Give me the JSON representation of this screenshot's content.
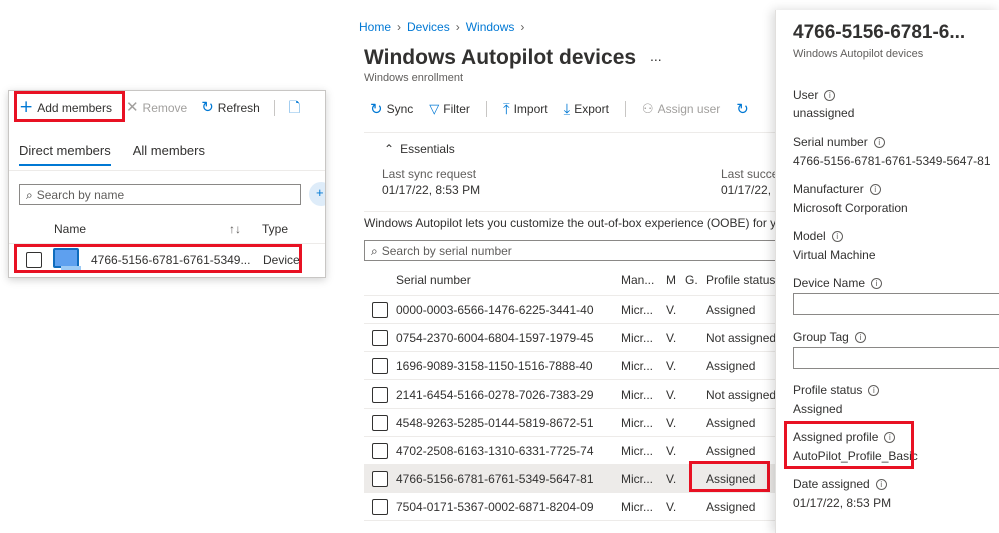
{
  "group": {
    "toolbar": {
      "add_members": "Add members",
      "remove": "Remove",
      "refresh": "Refresh"
    },
    "tabs": [
      "Direct members",
      "All members"
    ],
    "search_placeholder": "Search by name",
    "columns": {
      "name": "Name",
      "type": "Type"
    },
    "row": {
      "name": "4766-5156-6781-6761-5349...",
      "type": "Device"
    }
  },
  "autopilot": {
    "breadcrumb": [
      "Home",
      "Devices",
      "Windows"
    ],
    "title": "Windows Autopilot devices",
    "more": "...",
    "subtitle": "Windows enrollment",
    "toolbar": {
      "sync": "Sync",
      "filter": "Filter",
      "import": "Import",
      "export": "Export",
      "assign_user": "Assign user"
    },
    "essentials": {
      "label": "Essentials",
      "last_sync_label": "Last sync request",
      "last_sync_value": "01/17/22, 8:53 PM",
      "last_success_label": "Last succes",
      "last_success_value": "01/17/22,"
    },
    "description": "Windows Autopilot lets you customize the out-of-box experience (OOBE) for you",
    "search_placeholder": "Search by serial number",
    "columns": {
      "serial": "Serial number",
      "manufacturer": "Man...",
      "model": "M",
      "group": "G.",
      "profile_status": "Profile status"
    },
    "rows": [
      {
        "serial": "0000-0003-6566-1476-6225-3441-40",
        "man": "Micr...",
        "model": "V.",
        "status": "Assigned"
      },
      {
        "serial": "0754-2370-6004-6804-1597-1979-45",
        "man": "Micr...",
        "model": "V.",
        "status": "Not assigned"
      },
      {
        "serial": "1696-9089-3158-1150-1516-7888-40",
        "man": "Micr...",
        "model": "V.",
        "status": "Assigned"
      },
      {
        "serial": "2141-6454-5166-0278-7026-7383-29",
        "man": "Micr...",
        "model": "V.",
        "status": "Not assigned"
      },
      {
        "serial": "4548-9263-5285-0144-5819-8672-51",
        "man": "Micr...",
        "model": "V.",
        "status": "Assigned"
      },
      {
        "serial": "4702-2508-6163-1310-6331-7725-74",
        "man": "Micr...",
        "model": "V.",
        "status": "Assigned"
      },
      {
        "serial": "4766-5156-6781-6761-5349-5647-81",
        "man": "Micr...",
        "model": "V.",
        "status": "Assigned"
      },
      {
        "serial": "7504-0171-5367-0002-6871-8204-09",
        "man": "Micr...",
        "model": "V.",
        "status": "Assigned"
      }
    ]
  },
  "device": {
    "title": "4766-5156-6781-6...",
    "subtitle": "Windows Autopilot devices",
    "user_label": "User",
    "user_value": "unassigned",
    "serial_label": "Serial number",
    "serial_value": "4766-5156-6781-6761-5349-5647-81",
    "manufacturer_label": "Manufacturer",
    "manufacturer_value": "Microsoft Corporation",
    "model_label": "Model",
    "model_value": "Virtual Machine",
    "device_name_label": "Device Name",
    "group_tag_label": "Group Tag",
    "profile_status_label": "Profile status",
    "profile_status_value": "Assigned",
    "assigned_profile_label": "Assigned profile",
    "assigned_profile_value": "AutoPilot_Profile_Basic",
    "date_assigned_label": "Date assigned",
    "date_assigned_value": "01/17/22, 8:53 PM"
  },
  "colors": {
    "accent": "#0078d4",
    "highlight": "#e81123"
  }
}
